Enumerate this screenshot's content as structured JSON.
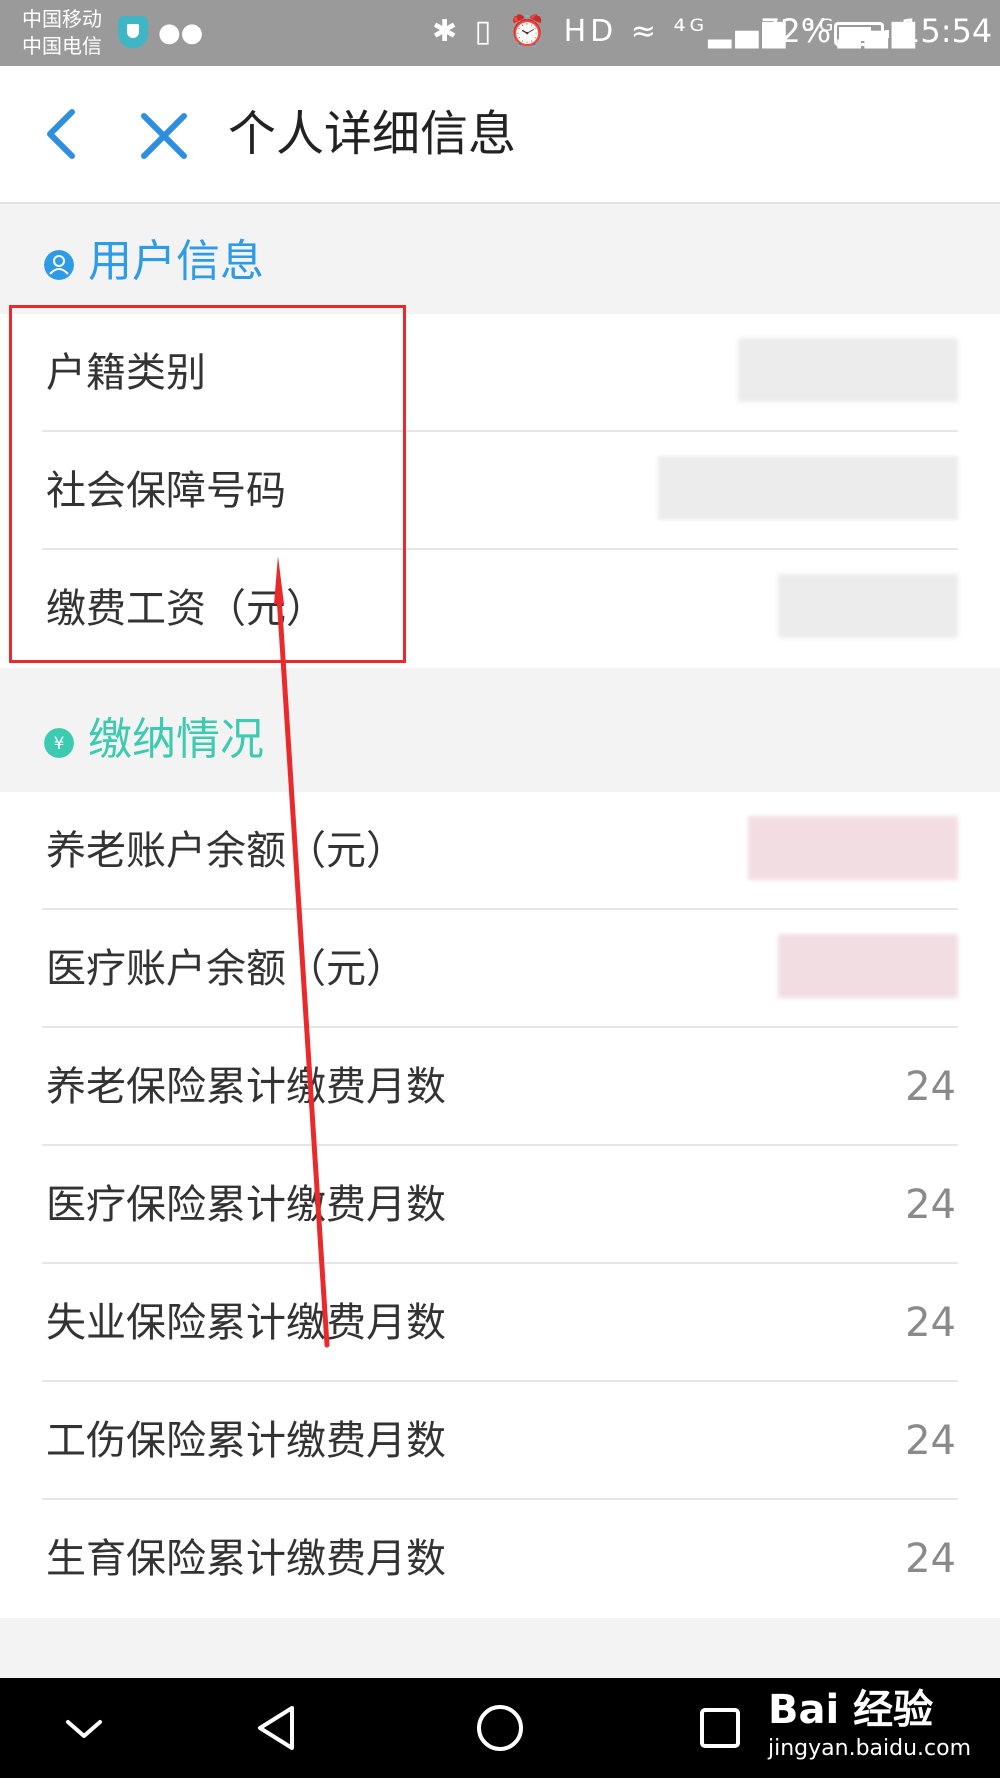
{
  "status_bar": {
    "carrier_1": "中国移动",
    "carrier_2": "中国电信",
    "icons": "✱ ▯ ⏰ HD ≈ ⁴ᴳ▂▄▆ ³ᴳ▂▄▆",
    "battery": "72%",
    "time": "15:54"
  },
  "header": {
    "title": "个人详细信息",
    "back_icon": "chevron-left-icon",
    "close_icon": "close-icon"
  },
  "sections": [
    {
      "title": "用户信息",
      "icon": "user-icon",
      "color": "#2e9be6",
      "rows": [
        {
          "label": "户籍类别",
          "value": ""
        },
        {
          "label": "社会保障号码",
          "value": ""
        },
        {
          "label": "缴费工资（元）",
          "value": ""
        }
      ]
    },
    {
      "title": "缴纳情况",
      "icon": "yen-icon",
      "color": "#3ccbb1",
      "rows": [
        {
          "label": "养老账户余额（元）",
          "value": ""
        },
        {
          "label": "医疗账户余额（元）",
          "value": ""
        },
        {
          "label": "养老保险累计缴费月数",
          "value": "24"
        },
        {
          "label": "医疗保险累计缴费月数",
          "value": "24"
        },
        {
          "label": "失业保险累计缴费月数",
          "value": "24"
        },
        {
          "label": "工伤保险累计缴费月数",
          "value": "24"
        },
        {
          "label": "生育保险累计缴费月数",
          "value": "24"
        }
      ]
    }
  ],
  "nav_bar": {
    "items": [
      "chevron-down-icon",
      "back-triangle-icon",
      "home-circle-icon",
      "recents-square-icon"
    ]
  },
  "watermark": {
    "logo": "Bai 经验",
    "url": "jingyan.baidu.com"
  },
  "annotation": {
    "color": "#ea2a2a"
  }
}
